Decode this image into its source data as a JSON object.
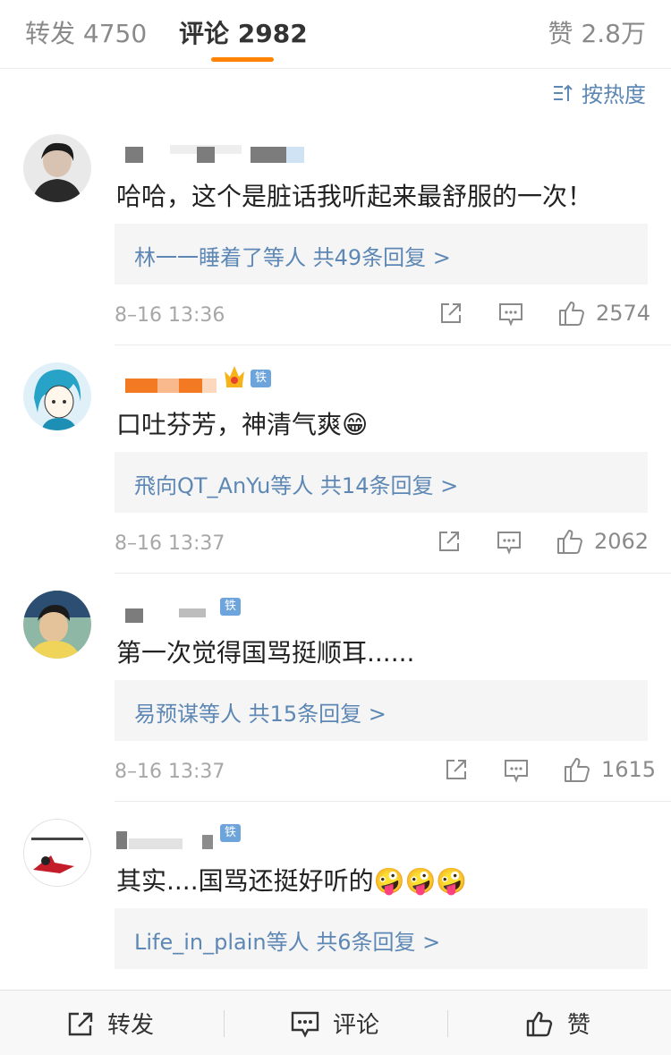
{
  "tabs": {
    "reposts": {
      "label": "转发",
      "count": "4750"
    },
    "comments": {
      "label": "评论",
      "count": "2982"
    },
    "likes": {
      "label": "赞",
      "count": "2.8万"
    }
  },
  "sort": {
    "label": "按热度"
  },
  "comments": [
    {
      "text": "哈哈，这个是脏话我听起来最舒服的一次！",
      "reply_summary": "林一一睡着了等人  共49条回复 >",
      "time": "8–16 13:36",
      "likes": "2574"
    },
    {
      "badge": "铁粉",
      "text": "口吐芬芳，神清气爽😁",
      "reply_summary": "飛向QT_AnYu等人  共14条回复 >",
      "time": "8–16 13:37",
      "likes": "2062"
    },
    {
      "badge": "铁粉",
      "text": "第一次觉得国骂挺顺耳......",
      "reply_summary": "易预谋等人  共15条回复 >",
      "time": "8–16 13:37",
      "likes": "1615"
    },
    {
      "badge": "铁粉",
      "text": "其实....国骂还挺好听的🤪🤪🤪",
      "reply_summary": "Life_in_plain等人  共6条回复 >"
    }
  ],
  "bottom_bar": {
    "repost": "转发",
    "comment": "评论",
    "like": "赞"
  },
  "colors": {
    "accent": "#ff8200",
    "link": "#5d87b4",
    "badge": "#6ea4dc"
  }
}
